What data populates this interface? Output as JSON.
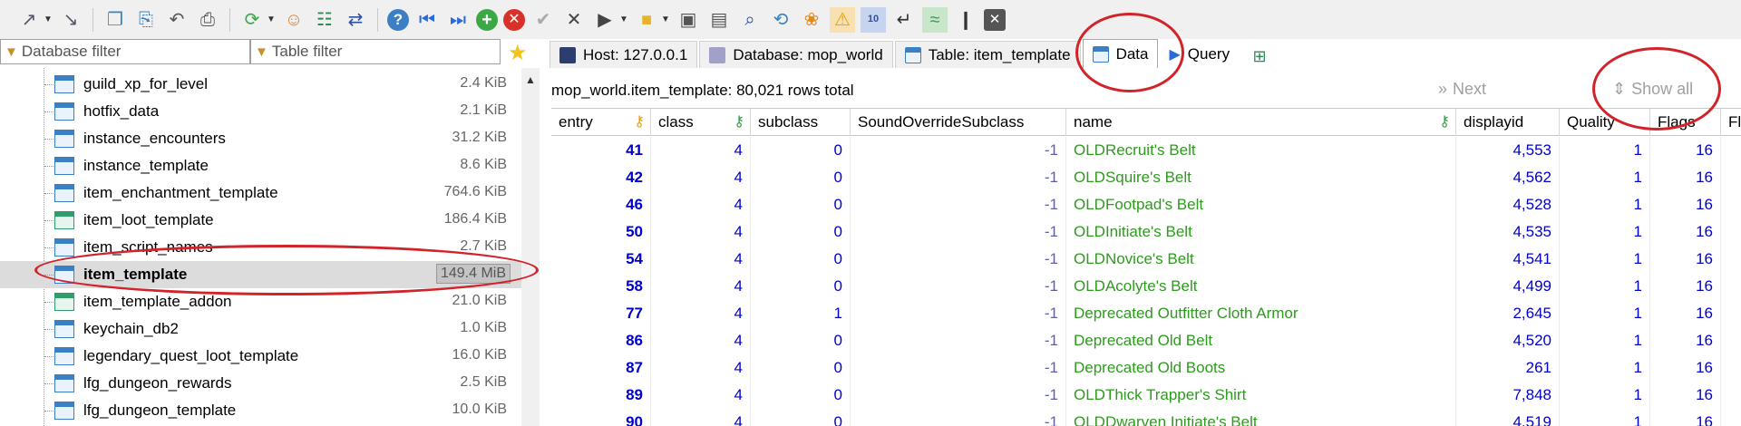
{
  "toolbar": {
    "icons": [
      "connect-icon",
      "disconnect-icon",
      "copy-icon",
      "paste-icon",
      "undo-icon",
      "print-icon",
      "refresh-icon",
      "user-manager-icon",
      "export-icon",
      "sync-icon",
      "help-icon",
      "first-icon",
      "last-icon",
      "add-icon",
      "delete-icon",
      "apply-icon",
      "cancel-icon",
      "run-icon",
      "open-folder-icon",
      "save-icon",
      "save-as-icon",
      "find-icon",
      "replace-icon",
      "clear-icon",
      "warning-icon",
      "binary-icon",
      "wrap-icon",
      "format-icon",
      "step-icon",
      "stop-icon"
    ]
  },
  "filters": {
    "database_placeholder": "Database filter",
    "table_placeholder": "Table filter"
  },
  "tabs": [
    {
      "label": "Host: 127.0.0.1"
    },
    {
      "label": "Database: mop_world"
    },
    {
      "label": "Table: item_template"
    },
    {
      "label": "Data"
    },
    {
      "label": "Query"
    }
  ],
  "tree": {
    "items": [
      {
        "name": "guild_xp_for_level",
        "size": "2.4 KiB"
      },
      {
        "name": "hotfix_data",
        "size": "2.1 KiB"
      },
      {
        "name": "instance_encounters",
        "size": "31.2 KiB"
      },
      {
        "name": "instance_template",
        "size": "8.6 KiB"
      },
      {
        "name": "item_enchantment_template",
        "size": "764.6 KiB"
      },
      {
        "name": "item_loot_template",
        "size": "186.4 KiB"
      },
      {
        "name": "item_script_names",
        "size": "2.7 KiB"
      },
      {
        "name": "item_template",
        "size": "149.4 MiB"
      },
      {
        "name": "item_template_addon",
        "size": "21.0 KiB"
      },
      {
        "name": "keychain_db2",
        "size": "1.0 KiB"
      },
      {
        "name": "legendary_quest_loot_template",
        "size": "16.0 KiB"
      },
      {
        "name": "lfg_dungeon_rewards",
        "size": "2.5 KiB"
      },
      {
        "name": "lfg_dungeon_template",
        "size": "10.0 KiB"
      }
    ]
  },
  "data_view": {
    "row_count": "mop_world.item_template: 80,021 rows total",
    "next_label": "Next",
    "show_all_label": "Show all",
    "columns": [
      "entry",
      "class",
      "subclass",
      "SoundOverrideSubclass",
      "name",
      "displayid",
      "Quality",
      "Flags",
      "Fla"
    ],
    "rows": [
      [
        "41",
        "4",
        "0",
        "-1",
        "OLDRecruit's Belt",
        "4,553",
        "1",
        "16"
      ],
      [
        "42",
        "4",
        "0",
        "-1",
        "OLDSquire's Belt",
        "4,562",
        "1",
        "16"
      ],
      [
        "46",
        "4",
        "0",
        "-1",
        "OLDFootpad's Belt",
        "4,528",
        "1",
        "16"
      ],
      [
        "50",
        "4",
        "0",
        "-1",
        "OLDInitiate's Belt",
        "4,535",
        "1",
        "16"
      ],
      [
        "54",
        "4",
        "0",
        "-1",
        "OLDNovice's Belt",
        "4,541",
        "1",
        "16"
      ],
      [
        "58",
        "4",
        "0",
        "-1",
        "OLDAcolyte's Belt",
        "4,499",
        "1",
        "16"
      ],
      [
        "77",
        "4",
        "1",
        "-1",
        "Deprecated Outfitter Cloth Armor",
        "2,645",
        "1",
        "16"
      ],
      [
        "86",
        "4",
        "0",
        "-1",
        "Deprecated Old Belt",
        "4,520",
        "1",
        "16"
      ],
      [
        "87",
        "4",
        "0",
        "-1",
        "Deprecated Old Boots",
        "261",
        "1",
        "16"
      ],
      [
        "89",
        "4",
        "0",
        "-1",
        "OLDThick Trapper's Shirt",
        "7,848",
        "1",
        "16"
      ],
      [
        "90",
        "4",
        "0",
        "-1",
        "OLDDwarven Initiate's Belt",
        "4,519",
        "1",
        "16"
      ]
    ]
  },
  "colors": {
    "annotation": "#d2232a",
    "number": "#0000cc",
    "text_value": "#2e9a1e"
  }
}
